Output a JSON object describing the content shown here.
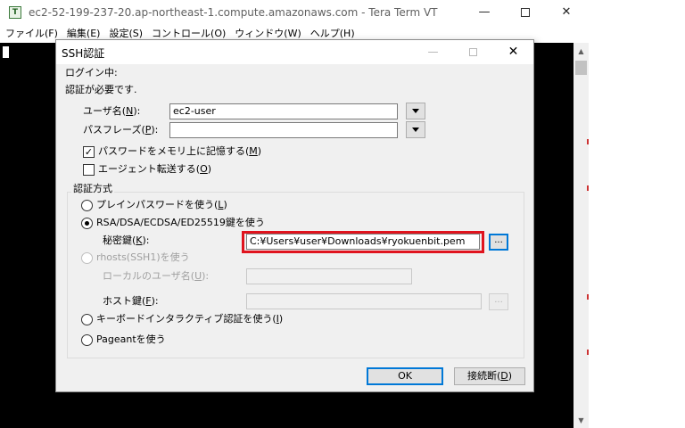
{
  "window": {
    "icon_letter": "T",
    "title": "ec2-52-199-237-20.ap-northeast-1.compute.amazonaws.com - Tera Term VT",
    "minimize_glyph": "—",
    "close_glyph": "✕"
  },
  "menu": [
    {
      "label": "ファイル(F)"
    },
    {
      "label": "編集(E)"
    },
    {
      "label": "設定(S)"
    },
    {
      "label": "コントロール(O)"
    },
    {
      "label": "ウィンドウ(W)"
    },
    {
      "label": "ヘルプ(H)"
    }
  ],
  "scrollbar": {
    "up_glyph": "▲",
    "down_glyph": "▼"
  },
  "dialog": {
    "title": "SSH認証",
    "minimize_glyph": "—",
    "close_glyph": "✕",
    "login_label": "ログイン中:",
    "auth_required": "認証が必要です.",
    "username": {
      "label_pre": "ユーザ名(",
      "key": "N",
      "label_post": "):",
      "value": "ec2-user"
    },
    "passphrase": {
      "label_pre": "パスフレーズ(",
      "key": "P",
      "label_post": "):",
      "value": ""
    },
    "remember_password": {
      "label_pre": "パスワードをメモリ上に記憶する(",
      "key": "M",
      "label_post": ")",
      "checked": true,
      "check_glyph": "✓"
    },
    "agent_forwarding": {
      "label_pre": "エージェント転送する(",
      "key": "O",
      "label_post": ")",
      "checked": false
    },
    "auth_method": {
      "group_label": "認証方式",
      "plain_password": {
        "label_pre": "プレインパスワードを使う(",
        "key": "L",
        "label_post": ")",
        "selected": false
      },
      "rsa_key": {
        "label": "RSA/DSA/ECDSA/ED25519鍵を使う",
        "selected": true
      },
      "private_key": {
        "label_pre": "秘密鍵(",
        "key": "K",
        "label_post": "):",
        "value": "C:¥Users¥user¥Downloads¥ryokuenbit.pem",
        "browse": "..."
      },
      "rhosts": {
        "label": "rhosts(SSH1)を使う",
        "selected": false,
        "enabled": false
      },
      "local_user": {
        "label_pre": "ローカルのユーザ名(",
        "key": "U",
        "label_post": "):",
        "value": ""
      },
      "host_key": {
        "label_pre": "ホスト鍵(",
        "key": "F",
        "label_post": "):",
        "value": "",
        "browse": "..."
      },
      "keyboard_interactive": {
        "label_pre": "キーボードインタラクティブ認証を使う(",
        "key": "I",
        "label_post": ")",
        "selected": false
      },
      "pageant": {
        "label": "Pageantを使う",
        "selected": false
      }
    },
    "ok_button": "OK",
    "disconnect_button": {
      "label_pre": "接続断(",
      "key": "D",
      "label_post": ")"
    }
  }
}
